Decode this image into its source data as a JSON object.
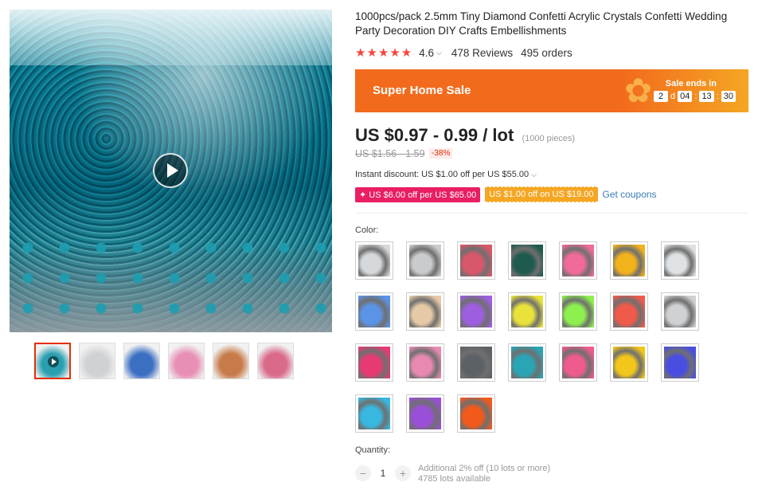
{
  "gallery": {
    "thumb_colors": [
      "#2a9fb0",
      "#cfd2d4",
      "#3b6fc2",
      "#e88fb6",
      "#c87b4a",
      "#d96a8a"
    ]
  },
  "product": {
    "title": "1000pcs/pack 2.5mm Tiny Diamond Confetti Acrylic Crystals Confetti Wedding Party Decoration DIY Crafts Embellishments",
    "stars": "★★★★★",
    "rating": "4.6",
    "reviews": "478 Reviews",
    "orders": "495 orders"
  },
  "banner": {
    "title": "Super Home Sale",
    "ends_label": "Sale ends in",
    "days": "2",
    "days_unit": "d",
    "hours": "04",
    "minutes": "13",
    "seconds": "30",
    "sep": ":"
  },
  "price": {
    "current": "US $0.97 - 0.99 / lot",
    "pieces": "(1000 pieces)",
    "original": "US $1.56 - 1.59",
    "discount": "-38%"
  },
  "promo": {
    "instant": "Instant discount: US $1.00 off per US $55.00",
    "coupon1": "✦ US $6.00 off per US $65.00",
    "coupon2": "US $1.00 off on US $19.00",
    "get_coupons": "Get coupons"
  },
  "color": {
    "label": "Color:",
    "swatches": [
      "#d6d9dc",
      "#c9cbcd",
      "#d9576a",
      "#1f5a4e",
      "#f06a9a",
      "#f2b21b",
      "#dfe2e4",
      "#5b93e6",
      "#e6c9a6",
      "#9d5fe0",
      "#e9e23a",
      "#8ef04f",
      "#f05a4a",
      "#cfd1d3",
      "#e83a72",
      "#e889b2",
      "#5c6166",
      "#2aa5b5",
      "#ef5b8e",
      "#f2c61a",
      "#4a4ee0",
      "#38b8e0",
      "#9a4fd8",
      "#f25a1c"
    ]
  },
  "quantity": {
    "label": "Quantity:",
    "minus": "−",
    "value": "1",
    "plus": "+",
    "additional": "Additional 2% off (10 lots or more)",
    "available": "4785 lots available"
  },
  "colors": {
    "accent": "#e62e04",
    "banner": "#f26b1d",
    "link": "#3a7cb8"
  }
}
